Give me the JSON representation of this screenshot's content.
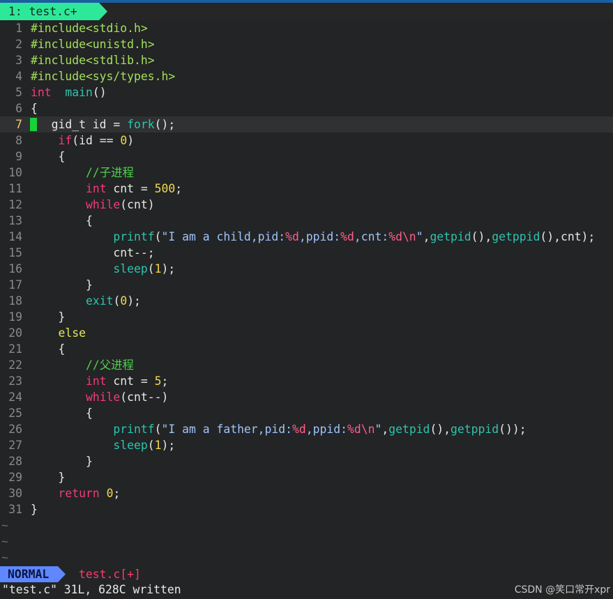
{
  "tab": {
    "label": "1: test.c+"
  },
  "colors": {
    "tab_bg": "#2ee89a",
    "mode_bg": "#5f87ff",
    "keyword": "#f33b7b",
    "function": "#2bc5b0",
    "number": "#f2d84a",
    "include": "#a3e05b",
    "comment": "#4cd24c",
    "string": "#9fc4ff",
    "cursor": "#16d33a"
  },
  "editor": {
    "current_line": 7,
    "lines": [
      {
        "n": "1",
        "tokens": [
          [
            "inc",
            "#include<stdio.h>"
          ]
        ]
      },
      {
        "n": "2",
        "tokens": [
          [
            "inc",
            "#include<unistd.h>"
          ]
        ]
      },
      {
        "n": "3",
        "tokens": [
          [
            "inc",
            "#include<stdlib.h>"
          ]
        ]
      },
      {
        "n": "4",
        "tokens": [
          [
            "inc",
            "#include<sys/types.h>"
          ]
        ]
      },
      {
        "n": "5",
        "tokens": [
          [
            "kw",
            "int"
          ],
          [
            "",
            "  "
          ],
          [
            "fn",
            "main"
          ],
          [
            "",
            "()"
          ]
        ]
      },
      {
        "n": "6",
        "tokens": [
          [
            "",
            "{"
          ]
        ]
      },
      {
        "n": "7",
        "tokens": [
          [
            "",
            "   gid_t id = "
          ],
          [
            "fn",
            "fork"
          ],
          [
            "",
            "();"
          ]
        ]
      },
      {
        "n": "8",
        "tokens": [
          [
            "",
            "    "
          ],
          [
            "kw",
            "if"
          ],
          [
            "",
            "(id == "
          ],
          [
            "num",
            "0"
          ],
          [
            "",
            ")"
          ]
        ]
      },
      {
        "n": "9",
        "tokens": [
          [
            "",
            "    {"
          ]
        ]
      },
      {
        "n": "10",
        "tokens": [
          [
            "",
            "        "
          ],
          [
            "cmt",
            "//子进程"
          ]
        ]
      },
      {
        "n": "11",
        "tokens": [
          [
            "",
            "        "
          ],
          [
            "kw",
            "int"
          ],
          [
            "",
            " cnt = "
          ],
          [
            "num",
            "500"
          ],
          [
            "",
            ";"
          ]
        ]
      },
      {
        "n": "12",
        "tokens": [
          [
            "",
            "        "
          ],
          [
            "kw",
            "while"
          ],
          [
            "",
            "(cnt)"
          ]
        ]
      },
      {
        "n": "13",
        "tokens": [
          [
            "",
            "        {"
          ]
        ]
      },
      {
        "n": "14",
        "tokens": [
          [
            "",
            "            "
          ],
          [
            "fn",
            "printf"
          ],
          [
            "",
            "("
          ],
          [
            "str",
            "\"I am a child,pid:"
          ],
          [
            "fmt",
            "%d"
          ],
          [
            "str",
            ",ppid:"
          ],
          [
            "fmt",
            "%d"
          ],
          [
            "str",
            ",cnt:"
          ],
          [
            "fmt",
            "%d\\n"
          ],
          [
            "str",
            "\""
          ],
          [
            "",
            ","
          ],
          [
            "fn",
            "getpid"
          ],
          [
            "",
            "(),"
          ],
          [
            "fn",
            "getppid"
          ],
          [
            "",
            "(),cnt);"
          ]
        ]
      },
      {
        "n": "15",
        "tokens": [
          [
            "",
            "            cnt--;"
          ]
        ]
      },
      {
        "n": "16",
        "tokens": [
          [
            "",
            "            "
          ],
          [
            "fn",
            "sleep"
          ],
          [
            "",
            "("
          ],
          [
            "num",
            "1"
          ],
          [
            "",
            "); "
          ]
        ]
      },
      {
        "n": "17",
        "tokens": [
          [
            "",
            "        }"
          ]
        ]
      },
      {
        "n": "18",
        "tokens": [
          [
            "",
            "        "
          ],
          [
            "fn",
            "exit"
          ],
          [
            "",
            "("
          ],
          [
            "num",
            "0"
          ],
          [
            "",
            ");"
          ]
        ]
      },
      {
        "n": "19",
        "tokens": [
          [
            "",
            "    }"
          ]
        ]
      },
      {
        "n": "20",
        "tokens": [
          [
            "",
            "    "
          ],
          [
            "ctl",
            "else"
          ]
        ]
      },
      {
        "n": "21",
        "tokens": [
          [
            "",
            "    {"
          ]
        ]
      },
      {
        "n": "22",
        "tokens": [
          [
            "",
            "        "
          ],
          [
            "cmt",
            "//父进程"
          ]
        ]
      },
      {
        "n": "23",
        "tokens": [
          [
            "",
            "        "
          ],
          [
            "kw",
            "int"
          ],
          [
            "",
            " cnt = "
          ],
          [
            "num",
            "5"
          ],
          [
            "",
            ";"
          ]
        ]
      },
      {
        "n": "24",
        "tokens": [
          [
            "",
            "        "
          ],
          [
            "kw",
            "while"
          ],
          [
            "",
            "(cnt--)"
          ]
        ]
      },
      {
        "n": "25",
        "tokens": [
          [
            "",
            "        {"
          ]
        ]
      },
      {
        "n": "26",
        "tokens": [
          [
            "",
            "            "
          ],
          [
            "fn",
            "printf"
          ],
          [
            "",
            "("
          ],
          [
            "str",
            "\"I am a father,pid:"
          ],
          [
            "fmt",
            "%d"
          ],
          [
            "str",
            ",ppid:"
          ],
          [
            "fmt",
            "%d\\n"
          ],
          [
            "str",
            "\""
          ],
          [
            "",
            ","
          ],
          [
            "fn",
            "getpid"
          ],
          [
            "",
            "(),"
          ],
          [
            "fn",
            "getppid"
          ],
          [
            "",
            "());"
          ]
        ]
      },
      {
        "n": "27",
        "tokens": [
          [
            "",
            "            "
          ],
          [
            "fn",
            "sleep"
          ],
          [
            "",
            "("
          ],
          [
            "num",
            "1"
          ],
          [
            "",
            ");"
          ]
        ]
      },
      {
        "n": "28",
        "tokens": [
          [
            "",
            "        }"
          ]
        ]
      },
      {
        "n": "29",
        "tokens": [
          [
            "",
            "    }"
          ]
        ]
      },
      {
        "n": "30",
        "tokens": [
          [
            "",
            "    "
          ],
          [
            "kw",
            "return"
          ],
          [
            "",
            " "
          ],
          [
            "num",
            "0"
          ],
          [
            "",
            ";"
          ]
        ]
      },
      {
        "n": "31",
        "tokens": [
          [
            "",
            "}"
          ]
        ]
      }
    ],
    "tildes": [
      "~",
      "~",
      "~"
    ]
  },
  "statusline": {
    "mode": "NORMAL",
    "filename": "test.c[+]"
  },
  "cmdline": {
    "message": "\"test.c\" 31L, 628C written"
  },
  "watermark": {
    "text": "CSDN @笑口常开xpr"
  }
}
